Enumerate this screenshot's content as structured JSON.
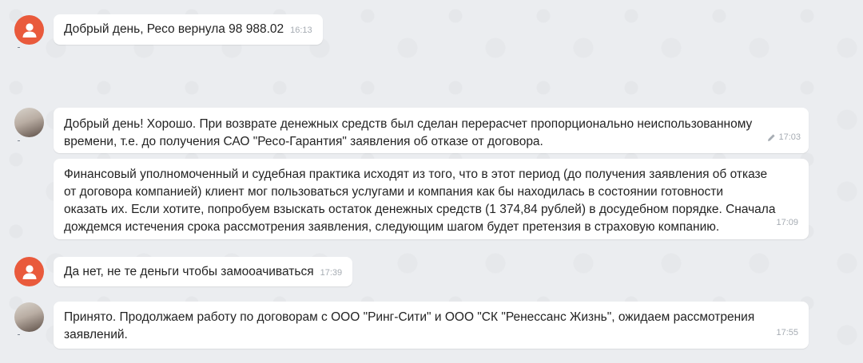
{
  "messages": [
    {
      "sender": "user",
      "text": "Добрый день, Ресо вернула 98 988.02",
      "time": "16:13"
    },
    {
      "sender": "agent",
      "text": "Добрый день! Хорошо. При возврате денежных средств был сделан перерасчет пропорционально неиспользованному\nвремени, т.е. до получения САО \"Ресо-Гарантия\" заявления об отказе от договора.",
      "time": "17:03",
      "edited_icon": "pencil-icon"
    },
    {
      "sender": "agent",
      "text": "Финансовый уполномоченный и судебная практика исходят из того, что в этот период (до получения заявления об отказе\nот договора компанией) клиент мог пользоваться услугами и компания как бы находилась в состоянии готовности\nоказать их. Если хотите, попробуем взыскать остаток денежных средств (1 374,84 рублей) в досудебном порядке. Сначала\nдождемся истечения срока рассмотрения заявления, следующим шагом будет претензия в страховую компанию.",
      "time": "17:09"
    },
    {
      "sender": "user",
      "text": "Да нет, не те деньги чтобы замооачиваться",
      "time": "17:39"
    },
    {
      "sender": "agent",
      "text": "Принято. Продолжаем работу по договорам с ООО \"Ринг-Сити\" и ООО \"СК \"Ренессанс Жизнь\", ожидаем рассмотрения\nзаявлений.",
      "time": "17:55"
    }
  ],
  "colors": {
    "background": "#ebedf0",
    "bubble": "#ffffff",
    "user_avatar": "#e95a3c",
    "timestamp": "#a6acb3"
  },
  "icons": {
    "user_avatar": "user-silhouette-icon",
    "agent_avatar": "photo-avatar"
  }
}
